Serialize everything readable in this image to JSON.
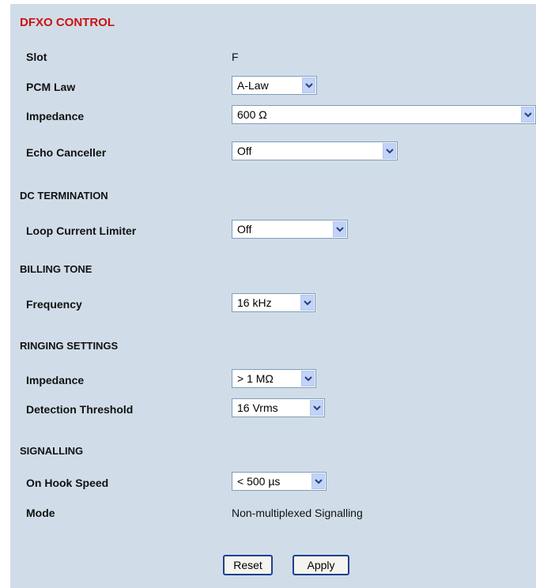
{
  "title": "DFXO CONTROL",
  "fields": {
    "slot": {
      "label": "Slot",
      "value": "F"
    },
    "pcm_law": {
      "label": "PCM Law",
      "value": "A-Law"
    },
    "impedance": {
      "label": "Impedance",
      "value": "600 Ω"
    },
    "echo_canceller": {
      "label": "Echo Canceller",
      "value": "Off"
    }
  },
  "dc_termination": {
    "heading": "DC TERMINATION",
    "loop_current_limiter": {
      "label": "Loop Current Limiter",
      "value": "Off"
    }
  },
  "billing_tone": {
    "heading": "BILLING TONE",
    "frequency": {
      "label": "Frequency",
      "value": "16 kHz"
    }
  },
  "ringing_settings": {
    "heading": "RINGING SETTINGS",
    "impedance": {
      "label": "Impedance",
      "value": "> 1 MΩ"
    },
    "detection_threshold": {
      "label": "Detection Threshold",
      "value": "16 Vrms"
    }
  },
  "signalling": {
    "heading": "SIGNALLING",
    "on_hook_speed": {
      "label": "On Hook Speed",
      "value": "< 500 µs"
    },
    "mode": {
      "label": "Mode",
      "value": "Non-multiplexed Signalling"
    }
  },
  "buttons": {
    "reset": "Reset",
    "apply": "Apply"
  },
  "icons": {
    "dropdown": "chevron-down-icon"
  },
  "colors": {
    "title": "#cc1111",
    "panel": "#d0dde8",
    "button_border": "#1f3f8f"
  }
}
